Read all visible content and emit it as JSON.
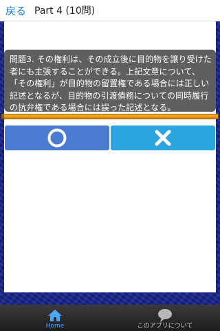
{
  "header": {
    "back_label": "戻る",
    "title": "Part 4 (10問)"
  },
  "question": {
    "text": "問題3. その権利は、その成立後に目的物を譲り受けた者にも主張することができる。上記文章について、「その権利」が目的物の留置権である場合には正しい記述となるが、目的物の引渡債務についての同時履行の抗弁権である場合には誤った記述となる。"
  },
  "progress": {
    "value_percent": 1
  },
  "answers": {
    "correct_symbol": "circle",
    "wrong_symbol": "cross"
  },
  "bottom_nav": {
    "home_label": "Home",
    "about_label": "このアプリについて"
  },
  "colors": {
    "accent_blue": "#1f7fd6",
    "button_correct": "#4a7bd0",
    "button_wrong": "#2aa5de",
    "progress_orange": "#e99a12"
  }
}
